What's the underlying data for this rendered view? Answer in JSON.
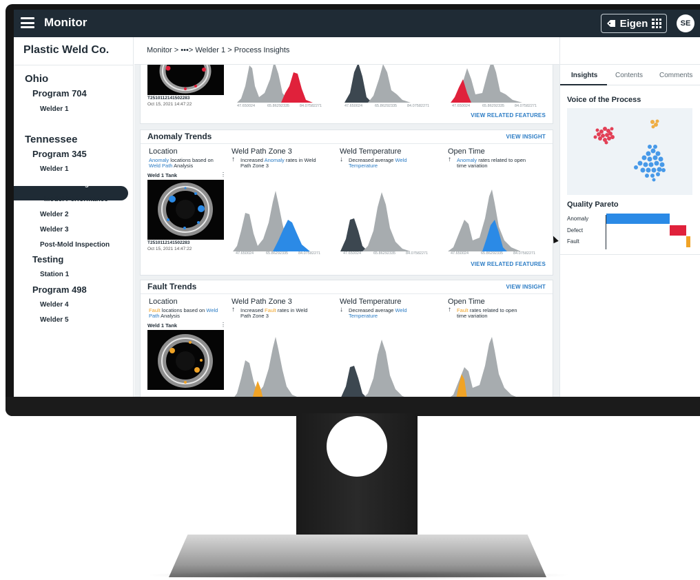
{
  "header": {
    "app_title": "Monitor",
    "brand": "Eigen",
    "avatar_initials": "SE"
  },
  "sidebar": {
    "org": "Plastic Weld Co.",
    "items": [
      {
        "label": "Ohio",
        "level": 1
      },
      {
        "label": "Program 704",
        "level": 2
      },
      {
        "label": "Welder 1",
        "level": 3
      },
      {
        "label": "Tennessee",
        "level": 1
      },
      {
        "label": "Program 345",
        "level": 2
      },
      {
        "label": "Welder 1",
        "level": 3
      },
      {
        "label": "Process Insights",
        "level": 4,
        "active": true
      },
      {
        "label": "Model Performance",
        "level": 4
      },
      {
        "label": "Welder 2",
        "level": 3
      },
      {
        "label": "Welder 3",
        "level": 3
      },
      {
        "label": "Post-Mold Inspection",
        "level": 3
      },
      {
        "label": "Testing",
        "level": 2
      },
      {
        "label": "Station 1",
        "level": 3
      },
      {
        "label": "Program 498",
        "level": 2
      },
      {
        "label": "Welder 4",
        "level": 3
      },
      {
        "label": "Welder 5",
        "level": 3
      }
    ]
  },
  "breadcrumb": {
    "root": "Monitor",
    "sep": ">",
    "ellipsis": "•••",
    "welder": "Welder 1",
    "current": "Process Insights"
  },
  "top_card": {
    "thumb_id": "T2510112141502283",
    "thumb_date": "Oct 15, 2021 14:47:22",
    "axis": [
      "47.650024",
      "65.86292335",
      "84.07582271"
    ],
    "view_related": "VIEW RELATED FEATURES"
  },
  "anomaly_card": {
    "title": "Anomaly Trends",
    "view_insight": "VIEW INSIGHT",
    "columns": [
      {
        "head": "Location",
        "arrow": "",
        "pre": "",
        "hl": "Anomaly",
        "mid": " locations based on ",
        "hl2": "Weld Path",
        "post": " Analysis"
      },
      {
        "head": "Weld Path Zone 3",
        "arrow": "↑",
        "pre": "Increased ",
        "hl": "Anomaly",
        "mid": " rates in Weld Path Zone 3",
        "hl2": "",
        "post": ""
      },
      {
        "head": "Weld Temperature",
        "arrow": "↓",
        "pre": "Decreased average ",
        "hl": "Weld Temperature",
        "mid": "",
        "hl2": "",
        "post": ""
      },
      {
        "head": "Open Time",
        "arrow": "↑",
        "pre": "",
        "hl": "Anomaly",
        "mid": " rates related to open time variation",
        "hl2": "",
        "post": ""
      }
    ],
    "tank_label": "Weld 1 Tank",
    "tank_more": "⋮",
    "thumb_id": "T2510112141502283",
    "thumb_date": "Oct 15, 2021 14:47:22",
    "axis": [
      "47.650024",
      "65.86292335",
      "84.07582271"
    ],
    "view_related": "VIEW RELATED FEATURES"
  },
  "fault_card": {
    "title": "Fault Trends",
    "view_insight": "VIEW INSIGHT",
    "columns": [
      {
        "head": "Location",
        "arrow": "",
        "pre": "",
        "hl": "Fault",
        "mid": " locations based on ",
        "hl2": "Weld Path",
        "post": " Analysis"
      },
      {
        "head": "Weld Path Zone 3",
        "arrow": "↑",
        "pre": "Increased ",
        "hl": "Fault",
        "mid": " rates in Weld Path Zone 3",
        "hl2": "",
        "post": ""
      },
      {
        "head": "Weld Temperature",
        "arrow": "↓",
        "pre": "Decreased average ",
        "hl": "Weld Temperature",
        "mid": "",
        "hl2": "",
        "post": ""
      },
      {
        "head": "Open Time",
        "arrow": "↑",
        "pre": "",
        "hl": "Fault",
        "mid": " rates related to open time variation",
        "hl2": "",
        "post": ""
      }
    ],
    "tank_label": "Weld 1 Tank",
    "tank_more": "⋮"
  },
  "right_panel": {
    "tabs": [
      "Insights",
      "Contents",
      "Comments"
    ],
    "active_tab": "Insights",
    "voice_title": "Voice of the Process",
    "pareto_title": "Quality Pareto",
    "pareto": [
      {
        "label": "Anomaly",
        "value": 100,
        "color": "#2b8ae6"
      },
      {
        "label": "Defect",
        "value": 25,
        "color": "#e0213b"
      },
      {
        "label": "Fault",
        "value": 7,
        "color": "#f0a326"
      }
    ]
  },
  "colors": {
    "dark": "#1f2b35",
    "link": "#2a7bc4",
    "anomaly": "#2b8ae6",
    "defect": "#e0213b",
    "fault": "#f0a326",
    "gray": "#a7acaf"
  }
}
